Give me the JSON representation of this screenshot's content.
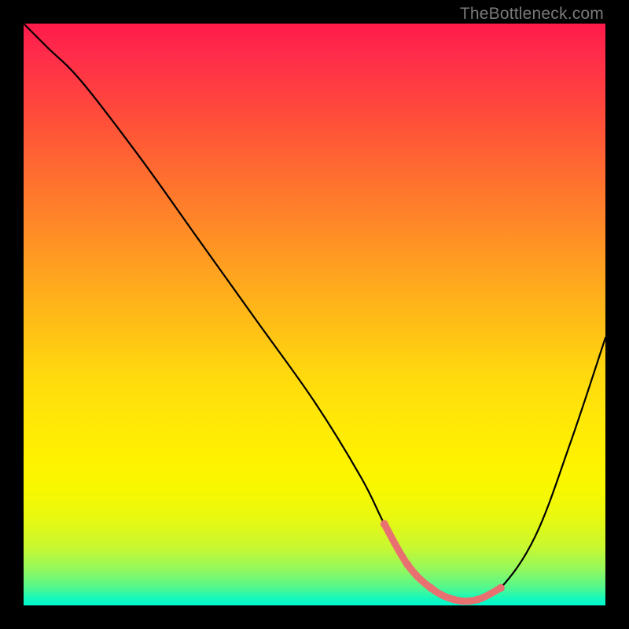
{
  "watermark": "TheBottleneck.com",
  "chart_data": {
    "type": "line",
    "title": "",
    "xlabel": "",
    "ylabel": "",
    "xlim": [
      0,
      100
    ],
    "ylim": [
      0,
      100
    ],
    "grid": false,
    "legend": false,
    "series": [
      {
        "name": "bottleneck-curve",
        "x": [
          0,
          4,
          10,
          20,
          30,
          40,
          50,
          58,
          62,
          66,
          70,
          74,
          78,
          82,
          88,
          94,
          100
        ],
        "y": [
          100,
          96,
          90,
          77,
          63,
          49,
          35,
          22,
          14,
          7,
          3,
          1,
          1,
          3,
          12,
          28,
          46
        ],
        "color": "#000000"
      },
      {
        "name": "optimal-range-highlight",
        "x": [
          62,
          66,
          70,
          74,
          78,
          82
        ],
        "y": [
          14,
          7,
          3,
          1,
          1,
          3
        ],
        "color": "#e97070"
      }
    ],
    "background_gradient": {
      "stops": [
        {
          "pos": 0,
          "color": "#ff1a4a"
        },
        {
          "pos": 50,
          "color": "#ffd80e"
        },
        {
          "pos": 75,
          "color": "#fff200"
        },
        {
          "pos": 100,
          "color": "#00f8d0"
        }
      ]
    }
  }
}
